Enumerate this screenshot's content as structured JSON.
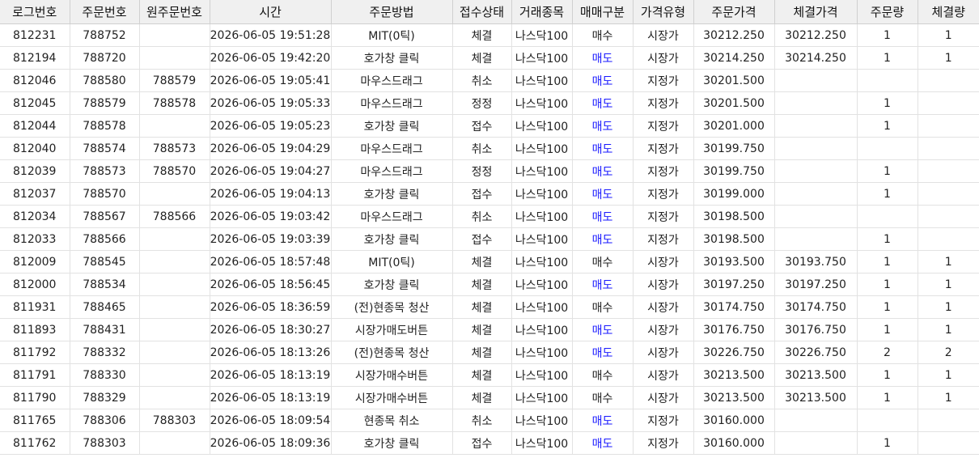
{
  "columns": [
    "로그번호",
    "주문번호",
    "원주문번호",
    "시간",
    "주문방법",
    "접수상태",
    "거래종목",
    "매매구분",
    "가격유형",
    "주문가격",
    "체결가격",
    "주문량",
    "체결량"
  ],
  "sell_color": "#1a1aff",
  "rows": [
    [
      "812231",
      "788752",
      "",
      "2026-06-05 19:51:28",
      "MIT(0틱)",
      "체결",
      "나스닥100",
      "매수",
      "시장가",
      "30212.250",
      "30212.250",
      "1",
      "1"
    ],
    [
      "812194",
      "788720",
      "",
      "2026-06-05 19:42:20",
      "호가창 클릭",
      "체결",
      "나스닥100",
      "매도",
      "시장가",
      "30214.250",
      "30214.250",
      "1",
      "1"
    ],
    [
      "812046",
      "788580",
      "788579",
      "2026-06-05 19:05:41",
      "마우스드래그",
      "취소",
      "나스닥100",
      "매도",
      "지정가",
      "30201.500",
      "",
      "",
      ""
    ],
    [
      "812045",
      "788579",
      "788578",
      "2026-06-05 19:05:33",
      "마우스드래그",
      "정정",
      "나스닥100",
      "매도",
      "지정가",
      "30201.500",
      "",
      "1",
      ""
    ],
    [
      "812044",
      "788578",
      "",
      "2026-06-05 19:05:23",
      "호가창 클릭",
      "접수",
      "나스닥100",
      "매도",
      "지정가",
      "30201.000",
      "",
      "1",
      ""
    ],
    [
      "812040",
      "788574",
      "788573",
      "2026-06-05 19:04:29",
      "마우스드래그",
      "취소",
      "나스닥100",
      "매도",
      "지정가",
      "30199.750",
      "",
      "",
      ""
    ],
    [
      "812039",
      "788573",
      "788570",
      "2026-06-05 19:04:27",
      "마우스드래그",
      "정정",
      "나스닥100",
      "매도",
      "지정가",
      "30199.750",
      "",
      "1",
      ""
    ],
    [
      "812037",
      "788570",
      "",
      "2026-06-05 19:04:13",
      "호가창 클릭",
      "접수",
      "나스닥100",
      "매도",
      "지정가",
      "30199.000",
      "",
      "1",
      ""
    ],
    [
      "812034",
      "788567",
      "788566",
      "2026-06-05 19:03:42",
      "마우스드래그",
      "취소",
      "나스닥100",
      "매도",
      "지정가",
      "30198.500",
      "",
      "",
      ""
    ],
    [
      "812033",
      "788566",
      "",
      "2026-06-05 19:03:39",
      "호가창 클릭",
      "접수",
      "나스닥100",
      "매도",
      "지정가",
      "30198.500",
      "",
      "1",
      ""
    ],
    [
      "812009",
      "788545",
      "",
      "2026-06-05 18:57:48",
      "MIT(0틱)",
      "체결",
      "나스닥100",
      "매수",
      "시장가",
      "30193.500",
      "30193.750",
      "1",
      "1"
    ],
    [
      "812000",
      "788534",
      "",
      "2026-06-05 18:56:45",
      "호가창 클릭",
      "체결",
      "나스닥100",
      "매도",
      "시장가",
      "30197.250",
      "30197.250",
      "1",
      "1"
    ],
    [
      "811931",
      "788465",
      "",
      "2026-06-05 18:36:59",
      "(전)현종목 청산",
      "체결",
      "나스닥100",
      "매수",
      "시장가",
      "30174.750",
      "30174.750",
      "1",
      "1"
    ],
    [
      "811893",
      "788431",
      "",
      "2026-06-05 18:30:27",
      "시장가매도버튼",
      "체결",
      "나스닥100",
      "매도",
      "시장가",
      "30176.750",
      "30176.750",
      "1",
      "1"
    ],
    [
      "811792",
      "788332",
      "",
      "2026-06-05 18:13:26",
      "(전)현종목 청산",
      "체결",
      "나스닥100",
      "매도",
      "시장가",
      "30226.750",
      "30226.750",
      "2",
      "2"
    ],
    [
      "811791",
      "788330",
      "",
      "2026-06-05 18:13:19",
      "시장가매수버튼",
      "체결",
      "나스닥100",
      "매수",
      "시장가",
      "30213.500",
      "30213.500",
      "1",
      "1"
    ],
    [
      "811790",
      "788329",
      "",
      "2026-06-05 18:13:19",
      "시장가매수버튼",
      "체결",
      "나스닥100",
      "매수",
      "시장가",
      "30213.500",
      "30213.500",
      "1",
      "1"
    ],
    [
      "811765",
      "788306",
      "788303",
      "2026-06-05 18:09:54",
      "현종목 취소",
      "취소",
      "나스닥100",
      "매도",
      "지정가",
      "30160.000",
      "",
      "",
      ""
    ],
    [
      "811762",
      "788303",
      "",
      "2026-06-05 18:09:36",
      "호가창 클릭",
      "접수",
      "나스닥100",
      "매도",
      "지정가",
      "30160.000",
      "",
      "1",
      ""
    ]
  ]
}
